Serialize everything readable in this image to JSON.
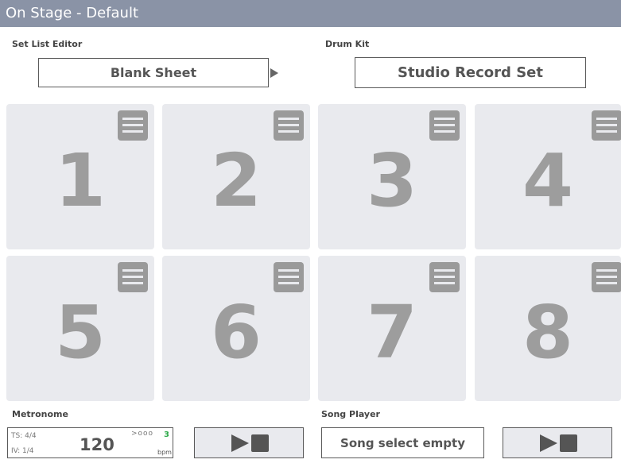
{
  "window": {
    "title": "On Stage - Default"
  },
  "set_list": {
    "label": "Set List Editor",
    "value": "Blank Sheet"
  },
  "drum_kit": {
    "label": "Drum Kit",
    "value": "Studio Record Set"
  },
  "pads": [
    {
      "number": "1"
    },
    {
      "number": "2"
    },
    {
      "number": "3"
    },
    {
      "number": "4"
    },
    {
      "number": "5"
    },
    {
      "number": "6"
    },
    {
      "number": "7"
    },
    {
      "number": "8"
    }
  ],
  "metronome": {
    "label": "Metronome",
    "time_signature": "TS: 4/4",
    "interval": "IV: 1/4",
    "tempo": "120",
    "beats": ">ooo",
    "count": "3",
    "unit": "bpm"
  },
  "song_player": {
    "label": "Song Player",
    "value": "Song select empty"
  },
  "colors": {
    "titlebar": "#8a93a6",
    "pad": "#e9eaee",
    "pad_number": "#9d9d9d",
    "count": "#2eaa4a"
  }
}
